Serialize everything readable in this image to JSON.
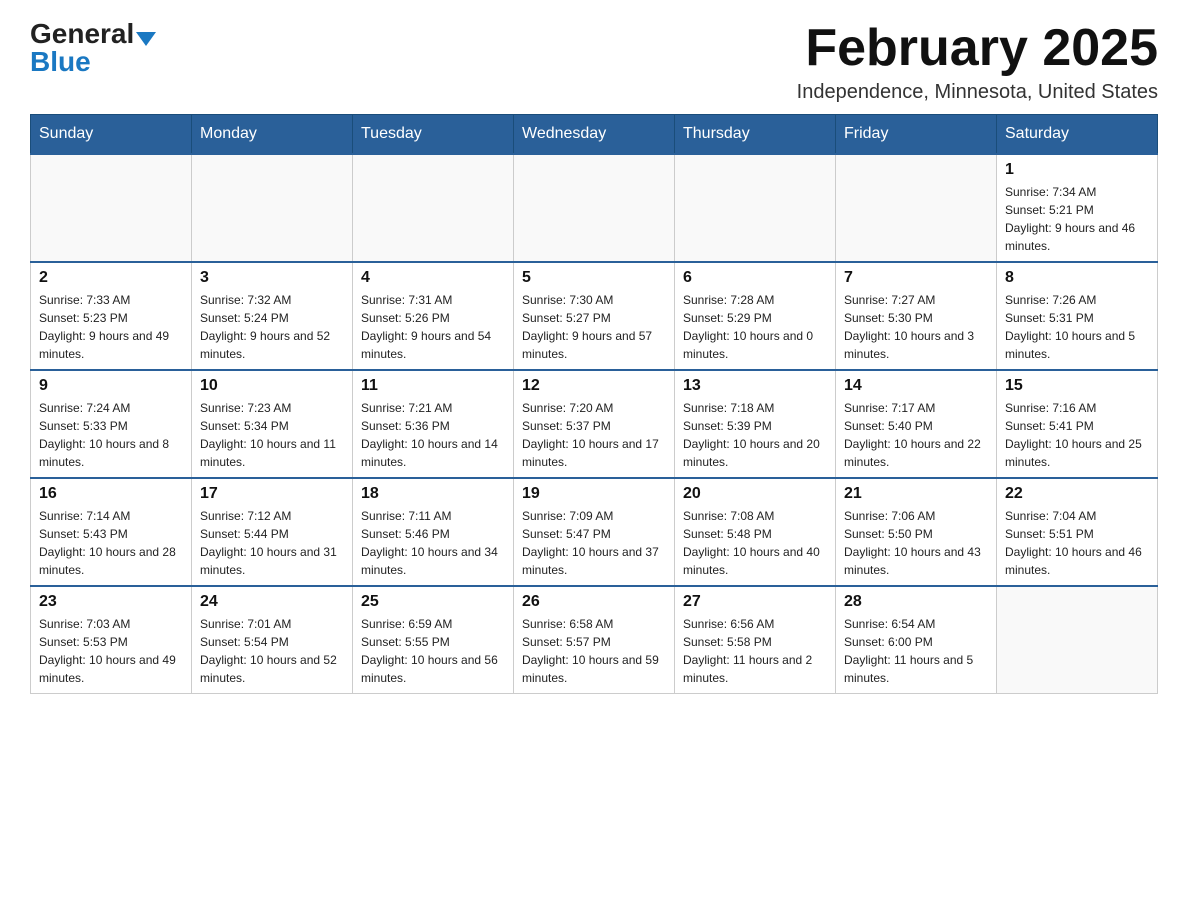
{
  "header": {
    "logo_general": "General",
    "logo_blue": "Blue",
    "title": "February 2025",
    "subtitle": "Independence, Minnesota, United States"
  },
  "weekdays": [
    "Sunday",
    "Monday",
    "Tuesday",
    "Wednesday",
    "Thursday",
    "Friday",
    "Saturday"
  ],
  "weeks": [
    [
      {
        "day": "",
        "info": ""
      },
      {
        "day": "",
        "info": ""
      },
      {
        "day": "",
        "info": ""
      },
      {
        "day": "",
        "info": ""
      },
      {
        "day": "",
        "info": ""
      },
      {
        "day": "",
        "info": ""
      },
      {
        "day": "1",
        "info": "Sunrise: 7:34 AM\nSunset: 5:21 PM\nDaylight: 9 hours and 46 minutes."
      }
    ],
    [
      {
        "day": "2",
        "info": "Sunrise: 7:33 AM\nSunset: 5:23 PM\nDaylight: 9 hours and 49 minutes."
      },
      {
        "day": "3",
        "info": "Sunrise: 7:32 AM\nSunset: 5:24 PM\nDaylight: 9 hours and 52 minutes."
      },
      {
        "day": "4",
        "info": "Sunrise: 7:31 AM\nSunset: 5:26 PM\nDaylight: 9 hours and 54 minutes."
      },
      {
        "day": "5",
        "info": "Sunrise: 7:30 AM\nSunset: 5:27 PM\nDaylight: 9 hours and 57 minutes."
      },
      {
        "day": "6",
        "info": "Sunrise: 7:28 AM\nSunset: 5:29 PM\nDaylight: 10 hours and 0 minutes."
      },
      {
        "day": "7",
        "info": "Sunrise: 7:27 AM\nSunset: 5:30 PM\nDaylight: 10 hours and 3 minutes."
      },
      {
        "day": "8",
        "info": "Sunrise: 7:26 AM\nSunset: 5:31 PM\nDaylight: 10 hours and 5 minutes."
      }
    ],
    [
      {
        "day": "9",
        "info": "Sunrise: 7:24 AM\nSunset: 5:33 PM\nDaylight: 10 hours and 8 minutes."
      },
      {
        "day": "10",
        "info": "Sunrise: 7:23 AM\nSunset: 5:34 PM\nDaylight: 10 hours and 11 minutes."
      },
      {
        "day": "11",
        "info": "Sunrise: 7:21 AM\nSunset: 5:36 PM\nDaylight: 10 hours and 14 minutes."
      },
      {
        "day": "12",
        "info": "Sunrise: 7:20 AM\nSunset: 5:37 PM\nDaylight: 10 hours and 17 minutes."
      },
      {
        "day": "13",
        "info": "Sunrise: 7:18 AM\nSunset: 5:39 PM\nDaylight: 10 hours and 20 minutes."
      },
      {
        "day": "14",
        "info": "Sunrise: 7:17 AM\nSunset: 5:40 PM\nDaylight: 10 hours and 22 minutes."
      },
      {
        "day": "15",
        "info": "Sunrise: 7:16 AM\nSunset: 5:41 PM\nDaylight: 10 hours and 25 minutes."
      }
    ],
    [
      {
        "day": "16",
        "info": "Sunrise: 7:14 AM\nSunset: 5:43 PM\nDaylight: 10 hours and 28 minutes."
      },
      {
        "day": "17",
        "info": "Sunrise: 7:12 AM\nSunset: 5:44 PM\nDaylight: 10 hours and 31 minutes."
      },
      {
        "day": "18",
        "info": "Sunrise: 7:11 AM\nSunset: 5:46 PM\nDaylight: 10 hours and 34 minutes."
      },
      {
        "day": "19",
        "info": "Sunrise: 7:09 AM\nSunset: 5:47 PM\nDaylight: 10 hours and 37 minutes."
      },
      {
        "day": "20",
        "info": "Sunrise: 7:08 AM\nSunset: 5:48 PM\nDaylight: 10 hours and 40 minutes."
      },
      {
        "day": "21",
        "info": "Sunrise: 7:06 AM\nSunset: 5:50 PM\nDaylight: 10 hours and 43 minutes."
      },
      {
        "day": "22",
        "info": "Sunrise: 7:04 AM\nSunset: 5:51 PM\nDaylight: 10 hours and 46 minutes."
      }
    ],
    [
      {
        "day": "23",
        "info": "Sunrise: 7:03 AM\nSunset: 5:53 PM\nDaylight: 10 hours and 49 minutes."
      },
      {
        "day": "24",
        "info": "Sunrise: 7:01 AM\nSunset: 5:54 PM\nDaylight: 10 hours and 52 minutes."
      },
      {
        "day": "25",
        "info": "Sunrise: 6:59 AM\nSunset: 5:55 PM\nDaylight: 10 hours and 56 minutes."
      },
      {
        "day": "26",
        "info": "Sunrise: 6:58 AM\nSunset: 5:57 PM\nDaylight: 10 hours and 59 minutes."
      },
      {
        "day": "27",
        "info": "Sunrise: 6:56 AM\nSunset: 5:58 PM\nDaylight: 11 hours and 2 minutes."
      },
      {
        "day": "28",
        "info": "Sunrise: 6:54 AM\nSunset: 6:00 PM\nDaylight: 11 hours and 5 minutes."
      },
      {
        "day": "",
        "info": ""
      }
    ]
  ]
}
